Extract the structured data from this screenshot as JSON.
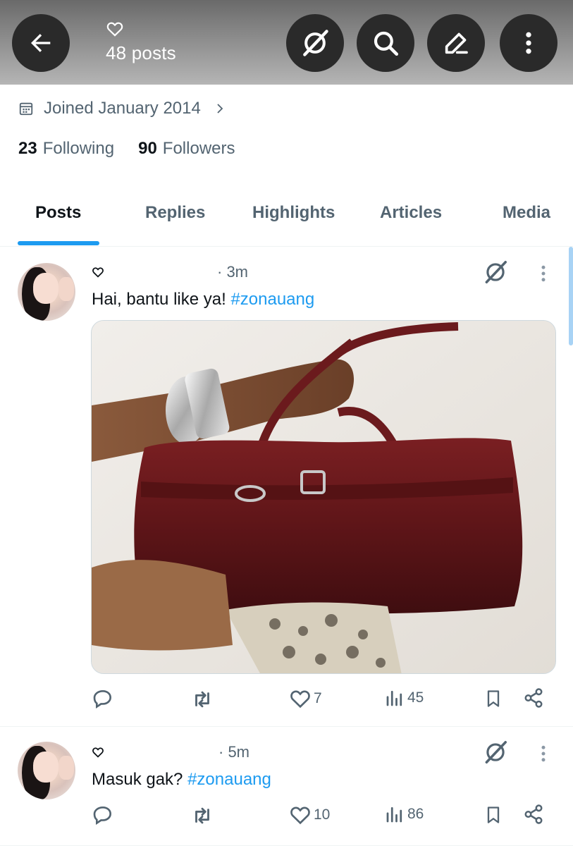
{
  "header": {
    "posts_count": "48 posts",
    "background": "#7a7a7a",
    "button_bg": "#2a2a2a",
    "icons": [
      "back-arrow-icon",
      "heart-icon",
      "grok-icon",
      "search-icon",
      "edit-icon",
      "more-vertical-icon"
    ]
  },
  "profile": {
    "joined": "Joined January 2014",
    "following_count": "23",
    "following_label": "Following",
    "followers_count": "90",
    "followers_label": "Followers"
  },
  "tabs": [
    {
      "label": "Posts",
      "active": true
    },
    {
      "label": "Replies",
      "active": false
    },
    {
      "label": "Highlights",
      "active": false
    },
    {
      "label": "Articles",
      "active": false
    },
    {
      "label": "Media",
      "active": false
    }
  ],
  "accent": "#1d9bf0",
  "posts": [
    {
      "time": "· 3m",
      "text": "Hai, bantu like ya! ",
      "hashtag": "#zonauang",
      "has_media": true,
      "media_description_icon": "photo",
      "replies": "",
      "reposts": "",
      "likes": "7",
      "views": "45"
    },
    {
      "time": "· 5m",
      "text": "Masuk gak? ",
      "hashtag": "#zonauang",
      "has_media": false,
      "replies": "",
      "reposts": "",
      "likes": "10",
      "views": "86"
    }
  ]
}
